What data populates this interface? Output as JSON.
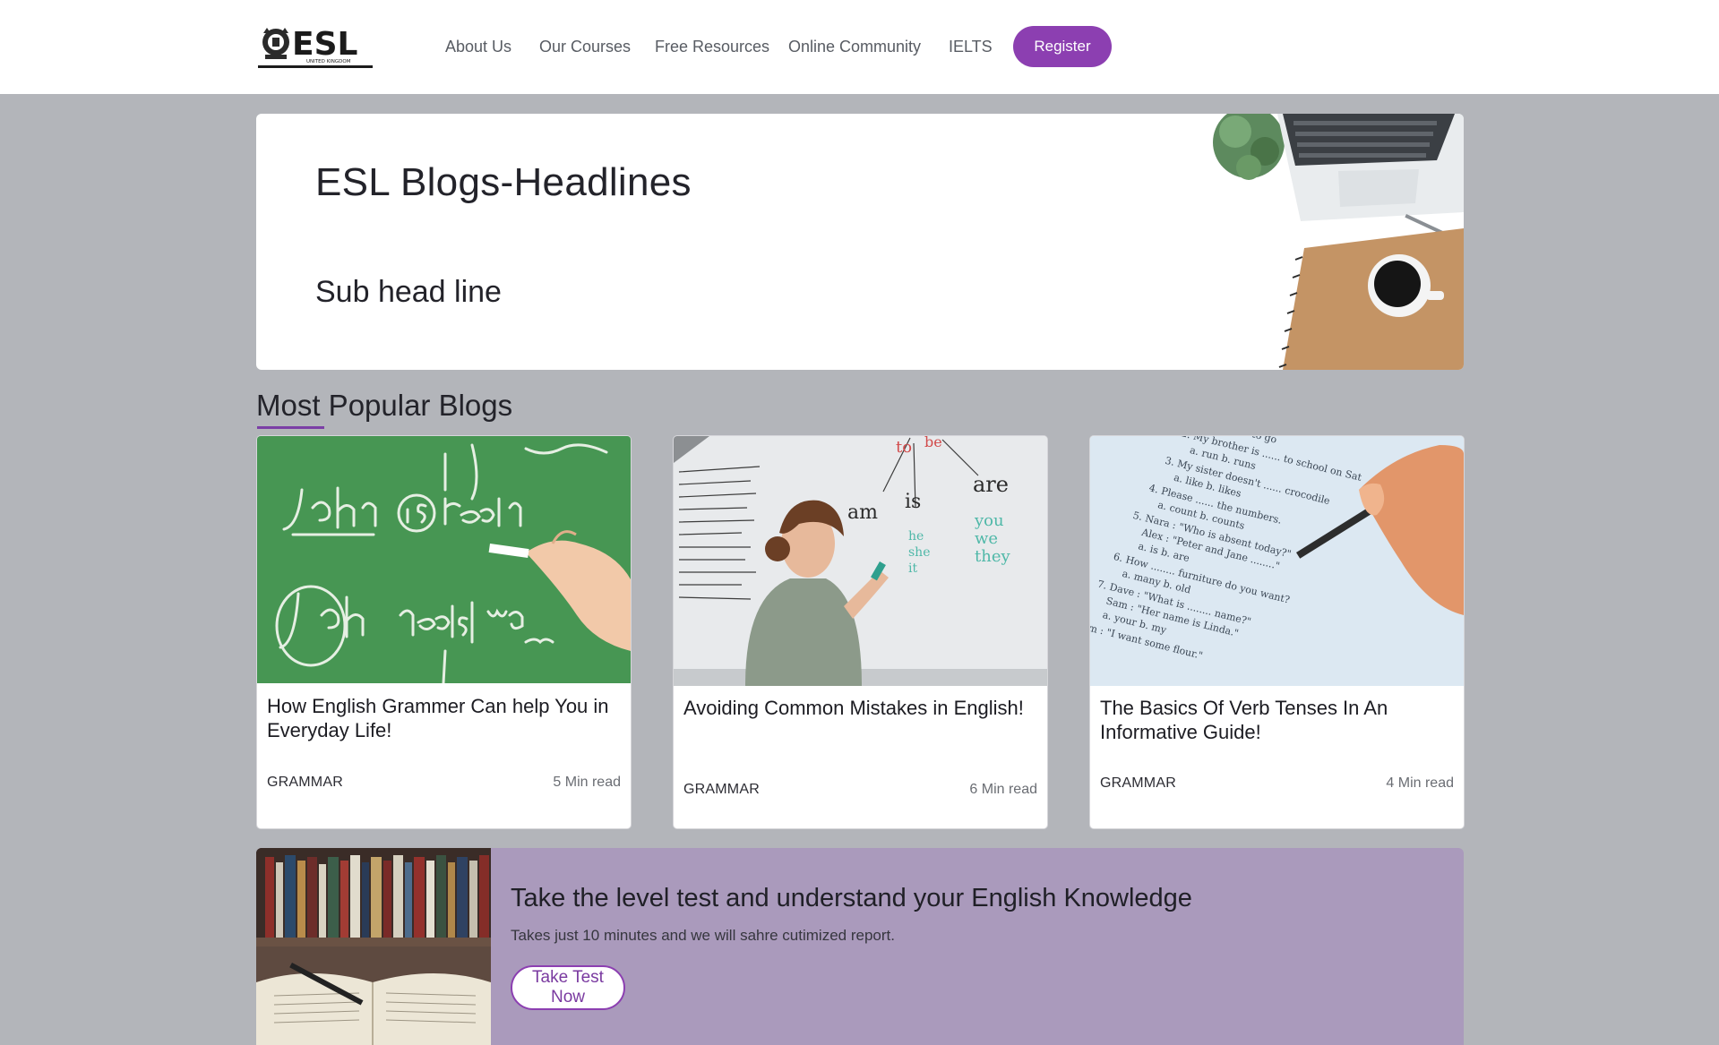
{
  "header": {
    "logo_text": "ESL",
    "logo_subtext": "UNITED KINGDOM",
    "nav": [
      "About Us",
      "Our Courses",
      "Free Resources",
      "Online Community",
      "IELTS"
    ],
    "register_label": "Register"
  },
  "hero": {
    "title": "ESL Blogs-Headlines",
    "subtitle": "Sub head line"
  },
  "popular": {
    "title": "Most Popular Blogs",
    "cards": [
      {
        "title": "How English Grammer Can help You in Everyday Life!",
        "category": "GRAMMAR",
        "read_time": "5 Min read"
      },
      {
        "title": "Avoiding Common Mistakes in English!",
        "category": "GRAMMAR",
        "read_time": "6 Min read"
      },
      {
        "title": "The Basics Of Verb Tenses In An Informative Guide!",
        "category": "GRAMMAR",
        "read_time": "4 Min read"
      }
    ]
  },
  "level_test": {
    "title": "Take the level test and understand your English Knowledge",
    "subtitle": "Takes just 10 minutes and we will sahre cutimized report.",
    "button_label": "Take Test Now"
  },
  "colors": {
    "accent": "#8c3fb1",
    "page_bg": "#b3b5ba",
    "banner_bg": "#aa9abc"
  },
  "icons": [
    "esl-logo-crest-icon"
  ]
}
